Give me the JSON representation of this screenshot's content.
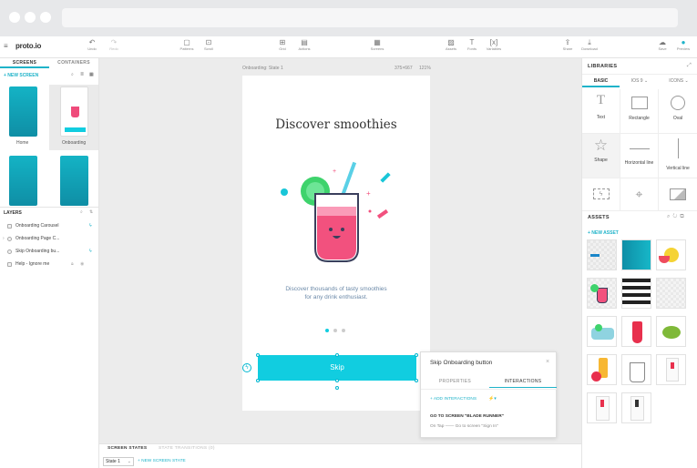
{
  "app": {
    "logo": "proto.io"
  },
  "toolbar": {
    "undo": "Undo",
    "redo": "Redo",
    "patterns": "Patterns",
    "scroll": "Scroll",
    "grid": "Grid",
    "actions": "Actions",
    "screens": "Screens",
    "assets": "Assets",
    "fonts": "Fonts",
    "variables": "Variables",
    "share": "Share",
    "download": "Download",
    "save": "Save",
    "preview": "Preview"
  },
  "left": {
    "tabs": [
      "SCREENS",
      "CONTAINERS"
    ],
    "new_screen": "+ NEW SCREEN",
    "screens": [
      "Home",
      "Onboarding"
    ],
    "layers_title": "LAYERS",
    "layers": [
      "Onboarding Carousel",
      "Onboarding Page C...",
      "Skip Onboarding bu...",
      "Help - Ignore me"
    ]
  },
  "canvas": {
    "screen_name": "Onboarding: State 1",
    "dims": "375×667",
    "zoom": "121%",
    "heading": "Discover smoothies",
    "body_line1": "Discover thousands of tasty smoothies",
    "body_line2": "for any drink enthusiast.",
    "skip_label": "Skip",
    "page_dots": 3,
    "active_dot": 1
  },
  "popup": {
    "title": "Skip Onboarding button",
    "tab_properties": "PROPERTIES",
    "tab_interactions": "INTERACTIONS",
    "add_interactions": "+ ADD INTERACTIONS",
    "goto": "GO TO SCREEN \"BLADE RUNNER\"",
    "on_tap": "On Tap ——  Go to screen \"Sign In\""
  },
  "bottom": {
    "tab_states": "SCREEN STATES",
    "tab_transitions": "STATE TRANSITIONS (0)",
    "state_value": "State 1",
    "new_state": "+ NEW SCREEN STATE"
  },
  "right": {
    "libraries": "LIBRARIES",
    "tabs": [
      "BASIC",
      "IOS 9",
      "ICONS"
    ],
    "items": [
      "Text",
      "Rectangle",
      "Oval",
      "Shape",
      "Horizontal line",
      "Vertical line"
    ],
    "assets_title": "ASSETS",
    "new_asset": "+ NEW ASSET"
  },
  "colors": {
    "accent": "#11cde0",
    "teal": "#14b3c5"
  }
}
